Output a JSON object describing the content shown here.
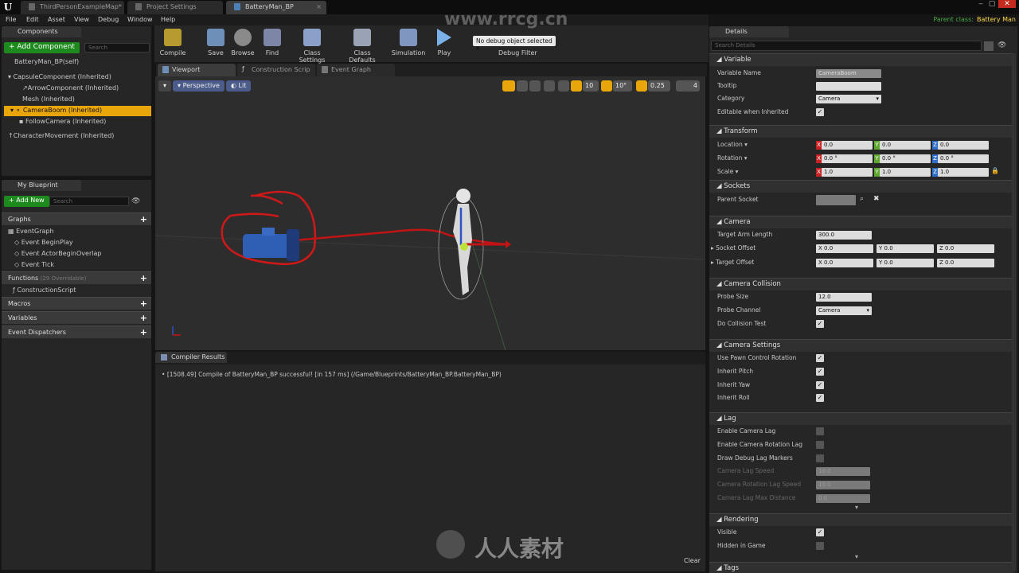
{
  "titlebar": {
    "logo": "U",
    "tabs": [
      "ThirdPersonExampleMap*",
      "Project Settings",
      "BatteryMan_BP"
    ],
    "close": "×",
    "parent_class_label": "Parent class:",
    "parent_class_value": "Battery Man"
  },
  "menu": [
    "File",
    "Edit",
    "Asset",
    "View",
    "Debug",
    "Window",
    "Help"
  ],
  "toolbar": {
    "buttons": [
      "Compile",
      "Save",
      "Browse",
      "Find",
      "Class Settings",
      "Class Defaults",
      "Simulation",
      "Play"
    ],
    "debug_select": "No debug object selected",
    "debug_filter": "Debug Filter"
  },
  "components": {
    "header": "Components",
    "add_button": "+ Add Component",
    "search_placeholder": "Search",
    "root": "BatteryMan_BP(self)",
    "items": [
      "CapsuleComponent (Inherited)",
      "ArrowComponent (Inherited)",
      "Mesh (Inherited)",
      "CameraBoom (Inherited)",
      "FollowCamera (Inherited)",
      "CharacterMovement (Inherited)"
    ]
  },
  "myblueprint": {
    "header": "My Blueprint",
    "add_button": "+ Add New",
    "search_placeholder": "Search",
    "graphs_label": "Graphs",
    "graph_items": [
      "EventGraph",
      "Event BeginPlay",
      "Event ActorBeginOverlap",
      "Event Tick"
    ],
    "functions_label": "Functions",
    "functions_count": "(29 Overridable)",
    "function_items": [
      "ConstructionScript"
    ],
    "macros": "Macros",
    "variables": "Variables",
    "dispatchers": "Event Dispatchers"
  },
  "editor_tabs": [
    "Viewport",
    "Construction Scrip",
    "Event Graph"
  ],
  "viewport": {
    "perspective": "Perspective",
    "lit": "Lit",
    "grid": "10",
    "angle": "10°",
    "scale": "0.25",
    "speed": "4"
  },
  "compiler": {
    "header": "Compiler Results",
    "log": "[1508.49] Compile of BatteryMan_BP successful! [in 157 ms] (/Game/Blueprints/BatteryMan_BP.BatteryMan_BP)",
    "clear": "Clear"
  },
  "details": {
    "header": "Details",
    "search_placeholder": "Search Details",
    "variable": {
      "title": "Variable",
      "name_label": "Variable Name",
      "name_value": "CameraBoom",
      "tooltip_label": "Tooltip",
      "category_label": "Category",
      "category_value": "Camera",
      "editable_label": "Editable when Inherited"
    },
    "transform": {
      "title": "Transform",
      "location": "Location",
      "rotation": "Rotation",
      "scale": "Scale",
      "loc": [
        "0.0",
        "0.0",
        "0.0"
      ],
      "rot": [
        "0.0 °",
        "0.0 °",
        "0.0 °"
      ],
      "scl": [
        "1.0",
        "1.0",
        "1.0"
      ]
    },
    "sockets": {
      "title": "Sockets",
      "parent_socket": "Parent Socket"
    },
    "camera": {
      "title": "Camera",
      "arm_label": "Target Arm Length",
      "arm_value": "300.0",
      "socket_label": "Socket Offset",
      "target_label": "Target Offset",
      "socket": [
        "0.0",
        "0.0",
        "0.0"
      ],
      "target": [
        "0.0",
        "0.0",
        "0.0"
      ]
    },
    "collision": {
      "title": "Camera Collision",
      "probe_size_label": "Probe Size",
      "probe_size": "12.0",
      "probe_channel_label": "Probe Channel",
      "probe_channel": "Camera",
      "do_test": "Do Collision Test"
    },
    "settings": {
      "title": "Camera Settings",
      "items": [
        "Use Pawn Control Rotation",
        "Inherit Pitch",
        "Inherit Yaw",
        "Inherit Roll"
      ]
    },
    "lag": {
      "title": "Lag",
      "items": [
        "Enable Camera Lag",
        "Enable Camera Rotation Lag",
        "Draw Debug Lag Markers"
      ],
      "dim_labels": [
        "Camera Lag Speed",
        "Camera Rotation Lag Speed",
        "Camera Lag Max Distance"
      ],
      "dim_values": [
        "10.0",
        "10.0",
        "0.0"
      ]
    },
    "rendering": {
      "title": "Rendering",
      "visible": "Visible",
      "hidden": "Hidden in Game"
    },
    "tags": {
      "title": "Tags"
    }
  },
  "watermark": {
    "url": "www.rrcg.cn",
    "brand": "人人素材"
  }
}
